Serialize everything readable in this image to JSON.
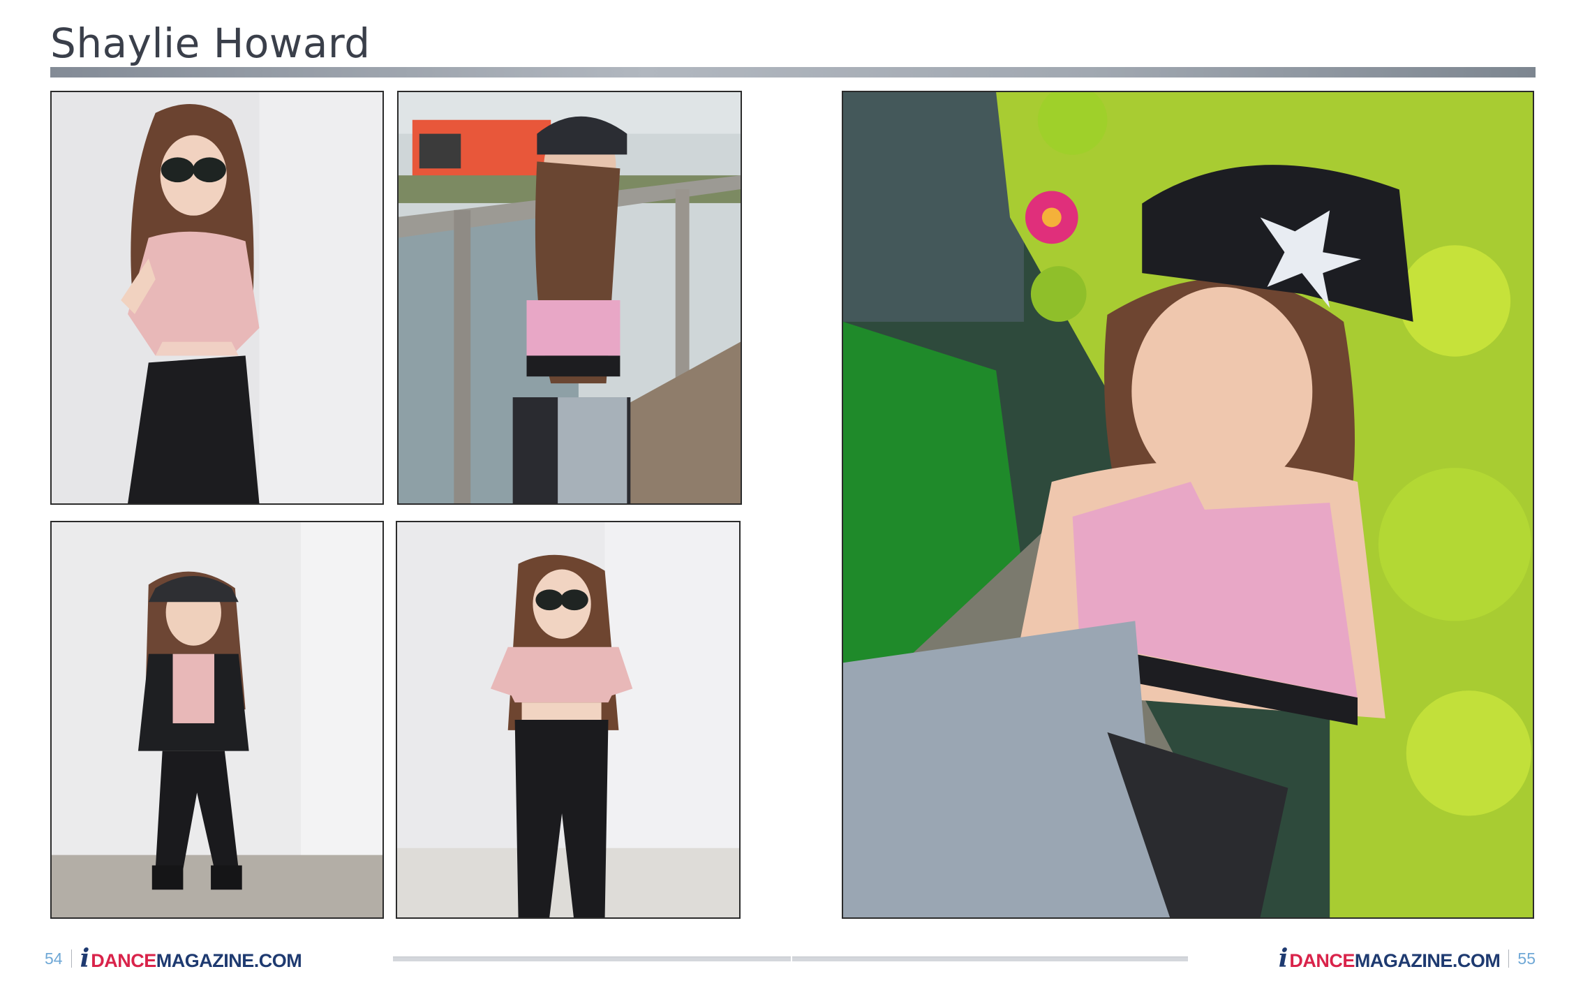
{
  "header": {
    "title": "Shaylie Howard"
  },
  "photos": [
    {
      "id": "photo-1",
      "description": "studio-pink-top-heart-sunglasses"
    },
    {
      "id": "photo-2",
      "description": "boardwalk-rhinestone-top-cap"
    },
    {
      "id": "photo-3",
      "description": "studio-black-jacket-cap"
    },
    {
      "id": "photo-4",
      "description": "studio-pink-top-heart-sunglasses-full"
    },
    {
      "id": "photo-5",
      "description": "flowers-rhinestone-outfit-sparkle-cap"
    }
  ],
  "footer": {
    "left_page": "54",
    "right_page": "55",
    "logo_i": "i",
    "logo_dance": "DANCE",
    "logo_magazine": "MAGAZINE.COM"
  },
  "colors": {
    "title_text": "#3a3f4a",
    "accent_red": "#d9234a",
    "brand_navy": "#1e3a70",
    "page_number": "#6fa8d6"
  }
}
